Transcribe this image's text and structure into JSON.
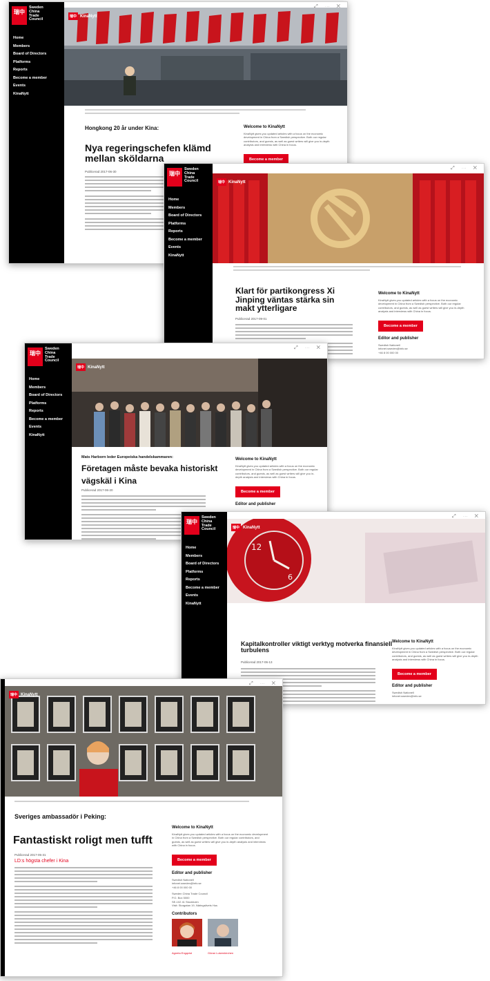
{
  "logo": {
    "mark": "瑞中",
    "text": [
      "Sweden",
      "China",
      "Trade",
      "Council"
    ]
  },
  "brand": "KinaNytt",
  "window_controls": "⤢ ⋯ ✕",
  "nav": [
    "Home",
    "Members",
    "Board of Directors",
    "Platforms",
    "Reports",
    "Become a member",
    "Events",
    "KinaNytt"
  ],
  "sidebar": {
    "welcome_title": "Welcome to KinaNytt",
    "welcome_text": "KinaNytt gives you updated articles with a focus on the economic development in China from a Swedish perspective. Both our regular contributors, and guests, as well as guest writers will give you in-depth analysis and interviews with China in focus.",
    "become_member": "Become a member",
    "editor_title": "Editor and publisher",
    "editor_lines": [
      "Swedish Nationell",
      "infonet.sweden@info.se",
      "+46 8 00 000 00"
    ],
    "council_lines": [
      "Sweden China Trade Council",
      "P.O. Box 5000",
      "SE-102 41 Stockholm",
      "Visit: Storgatan 19, Näringslivets Hus"
    ],
    "contributors_title": "Contributors",
    "contributor_names": [
      "Agneta Engqvist",
      "Göran Lutzenkirchen"
    ]
  },
  "articles": [
    {
      "kicker": "Hongkong 20 år under Kina:",
      "headline": "Nya regeringschefen klämd mellan sköldarna",
      "pub": "Publicerad 2017-06-30"
    },
    {
      "kicker": "",
      "headline": "Klart för partikongress Xi Jinping väntas stärka sin makt ytterligare",
      "pub": "Publicerad 2017-09-01"
    },
    {
      "kicker": "Mats Harborn leder Europeiska handelskammaren:",
      "headline": "Företagen måste bevaka historiskt vägskäl i Kina",
      "pub": "Publicerad 2017-06-20"
    },
    {
      "kicker": "",
      "headline": "Kapitalkontroller viktigt verktyg motverka finansiell turbulens",
      "pub": "Publicerad 2017-06-13"
    },
    {
      "kicker": "Sveriges ambassadör i Peking:",
      "headline": "Fantastiskt roligt men tufft",
      "pub": "Publicerad 2017-05-31"
    }
  ],
  "link": "LD:s högsta chefer i Kina",
  "colors": {
    "accent": "#e3001b",
    "sidebar_bg": "#000000"
  },
  "icons": [
    "share-icon",
    "back-arrow-icon",
    "close-icon"
  ]
}
